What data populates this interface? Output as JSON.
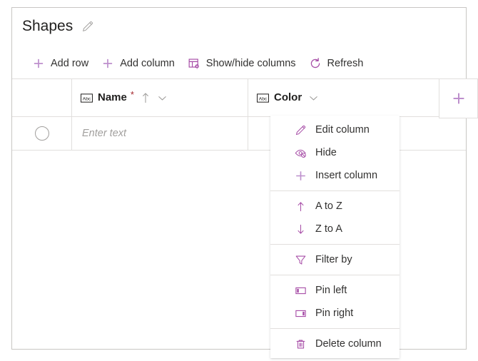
{
  "panel": {
    "title": "Shapes",
    "edit_title_icon": "pencil-icon"
  },
  "toolbar": {
    "items": [
      {
        "label": "Add row",
        "icon": "plus-icon"
      },
      {
        "label": "Add column",
        "icon": "plus-icon"
      },
      {
        "label": "Show/hide columns",
        "icon": "table-settings-icon"
      },
      {
        "label": "Refresh",
        "icon": "refresh-icon"
      }
    ]
  },
  "grid": {
    "columns": [
      {
        "name": "Name",
        "type_icon": "abc-text-icon",
        "required": true,
        "required_mark": "*",
        "sorted": true,
        "sort_icon": "arrow-up-icon",
        "menu_icon": "chevron-down-icon"
      },
      {
        "name": "Color",
        "type_icon": "abc-text-icon",
        "required": false,
        "required_mark": "",
        "sorted": false,
        "sort_icon": "",
        "menu_icon": "chevron-down-icon"
      }
    ],
    "add_column_icon": "plus-icon",
    "rows": [
      {
        "selector_icon": "radio-circle-icon",
        "cells": [
          {
            "value": "",
            "placeholder": "Enter text"
          },
          {
            "value": "",
            "placeholder": ""
          }
        ]
      }
    ]
  },
  "column_menu": {
    "open_for_column": "Color",
    "items": [
      {
        "label": "Edit column",
        "icon": "pencil-icon",
        "divider_after": false
      },
      {
        "label": "Hide",
        "icon": "hide-eye-icon",
        "divider_after": false
      },
      {
        "label": "Insert column",
        "icon": "plus-icon",
        "divider_after": true
      },
      {
        "label": "A to Z",
        "icon": "arrow-up-icon",
        "divider_after": false
      },
      {
        "label": "Z to A",
        "icon": "arrow-down-icon",
        "divider_after": true
      },
      {
        "label": "Filter by",
        "icon": "funnel-icon",
        "divider_after": true
      },
      {
        "label": "Pin left",
        "icon": "pin-left-icon",
        "divider_after": false
      },
      {
        "label": "Pin right",
        "icon": "pin-right-icon",
        "divider_after": true
      },
      {
        "label": "Delete column",
        "icon": "trash-icon",
        "divider_after": false
      }
    ]
  },
  "colors": {
    "accent_purple": "#a64ca6",
    "light_purple": "#bd8fcc",
    "required_red": "#a4262c",
    "text": "#323130",
    "border": "#e1dfdd",
    "panel_border": "#c8c6c4"
  }
}
